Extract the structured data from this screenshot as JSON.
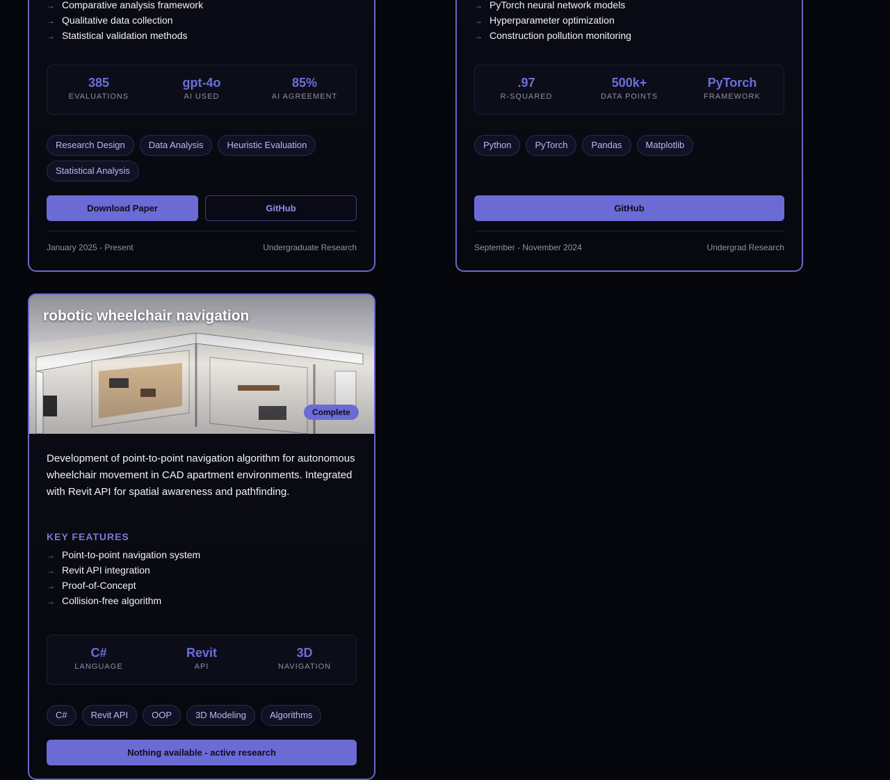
{
  "card_a": {
    "features": [
      "Comparative analysis framework",
      "Qualitative data collection",
      "Statistical validation methods"
    ],
    "stats": [
      {
        "value": "385",
        "label": "Evaluations"
      },
      {
        "value": "gpt-4o",
        "label": "AI Used"
      },
      {
        "value": "85%",
        "label": "AI Agreement"
      }
    ],
    "tags": [
      "Research Design",
      "Data Analysis",
      "Heuristic Evaluation",
      "Statistical Analysis"
    ],
    "buttons": {
      "download": "Download Paper",
      "github": "GitHub"
    },
    "footer": {
      "date": "January 2025 - Present",
      "category": "Undergraduate Research"
    }
  },
  "card_b": {
    "features": [
      "PyTorch neural network models",
      "Hyperparameter optimization",
      "Construction pollution monitoring"
    ],
    "stats": [
      {
        "value": ".97",
        "label": "R-Squared"
      },
      {
        "value": "500k+",
        "label": "Data Points"
      },
      {
        "value": "PyTorch",
        "label": "Framework"
      }
    ],
    "tags": [
      "Python",
      "PyTorch",
      "Pandas",
      "Matplotlib"
    ],
    "buttons": {
      "github": "GitHub"
    },
    "footer": {
      "date": "September - November 2024",
      "category": "Undergrad Research"
    }
  },
  "card_c": {
    "title": "robotic wheelchair navigation",
    "status": "Complete",
    "description": "Development of point-to-point navigation algorithm for autonomous wheelchair movement in CAD apartment environments. Integrated with Revit API for spatial awareness and pathfinding.",
    "section_title": "KEY FEATURES",
    "features": [
      "Point-to-point navigation system",
      "Revit API integration",
      "Proof-of-Concept",
      "Collision-free algorithm"
    ],
    "stats": [
      {
        "value": "C#",
        "label": "Language"
      },
      {
        "value": "Revit",
        "label": "API"
      },
      {
        "value": "3D",
        "label": "Navigation"
      }
    ],
    "tags": [
      "C#",
      "Revit API",
      "OOP",
      "3D Modeling",
      "Algorithms"
    ],
    "buttons": {
      "primary": "Nothing available - active research"
    }
  },
  "icons": {
    "feature_bullet": "arrow-right-icon"
  },
  "colors": {
    "accent": "#6a6bd4",
    "border": "#6a67c8",
    "background": "#06060d"
  }
}
